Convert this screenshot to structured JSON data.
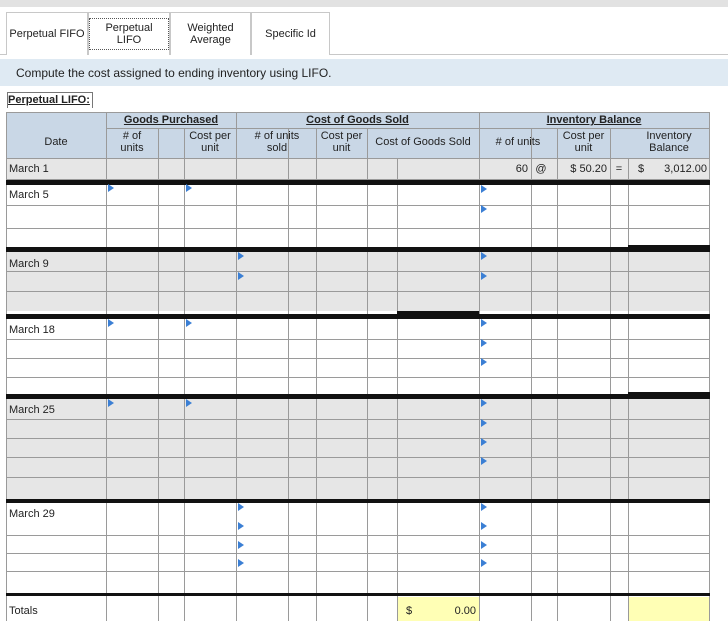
{
  "tabs": [
    {
      "label": "Perpetual FIFO",
      "active": false
    },
    {
      "label": "Perpetual LIFO",
      "active": true
    },
    {
      "label_line1": "Weighted",
      "label_line2": "Average",
      "active": false
    },
    {
      "label": "Specific Id",
      "active": false
    }
  ],
  "instruction": "Compute the cost assigned to ending inventory using LIFO.",
  "table_title": "Perpetual LIFO:",
  "headers": {
    "date": "Date",
    "goods_purchased": "Goods Purchased",
    "gp_units_1": "# of",
    "gp_units_2": "units",
    "gp_cost_1": "Cost per",
    "gp_cost_2": "unit",
    "cogs": "Cost of Goods Sold",
    "cogs_units_1": "# of units",
    "cogs_units_2": "sold",
    "cogs_cost_1": "Cost per",
    "cogs_cost_2": "unit",
    "cogs_total": "Cost of Goods Sold",
    "inventory_balance": "Inventory Balance",
    "ib_units": "# of units",
    "ib_cost_1": "Cost per",
    "ib_cost_2": "unit",
    "ib_bal_1": "Inventory",
    "ib_bal_2": "Balance"
  },
  "rows": {
    "march1": {
      "date": "March 1",
      "units": "60",
      "at": "@",
      "cost": "$ 50.20",
      "eq": "=",
      "dollar": "$",
      "balance": "3,012.00"
    },
    "march5": "March 5",
    "march9": "March 9",
    "march18": "March 18",
    "march25": "March 25",
    "march29": "March 29",
    "totals": "Totals",
    "totals_dollar": "$",
    "totals_cogs": "0.00"
  },
  "colors": {
    "accent_arrow": "#3b7fd4",
    "header_bg": "#dfeaf3",
    "shaded_row": "#e6e6e6",
    "highlight": "#ffffb5"
  }
}
